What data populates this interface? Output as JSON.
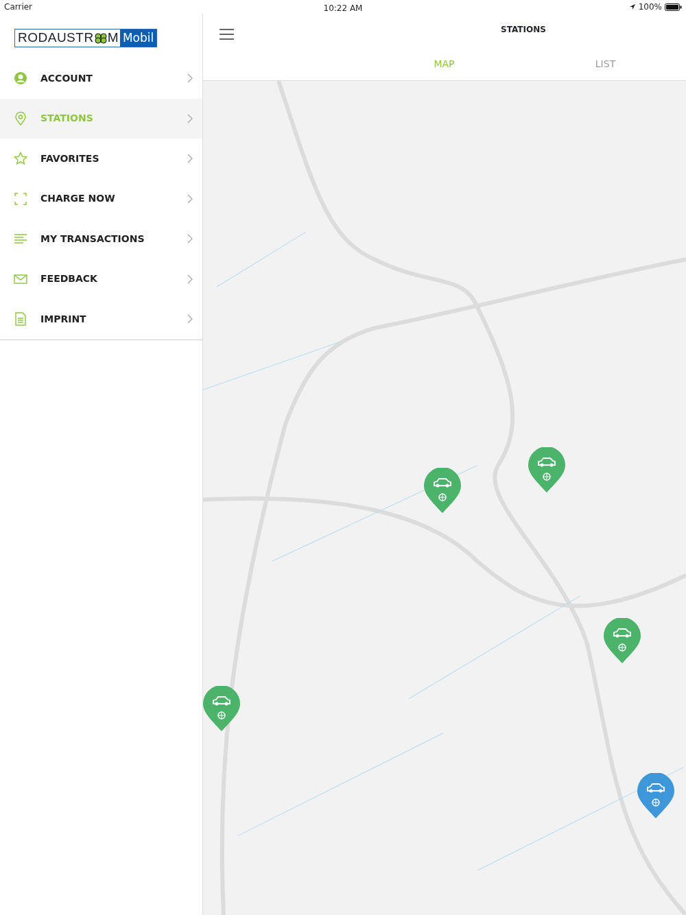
{
  "status_bar": {
    "carrier": "Carrier",
    "time": "10:22 AM",
    "battery": "100%"
  },
  "logo": {
    "left": "RODAUSTR",
    "right": "M",
    "badge": "Mobil"
  },
  "menu": [
    {
      "label": "ACCOUNT",
      "kind": "account",
      "selected": false
    },
    {
      "label": "STATIONS",
      "kind": "stations",
      "selected": true
    },
    {
      "label": "FAVORITES",
      "kind": "favorites",
      "selected": false
    },
    {
      "label": "CHARGE NOW",
      "kind": "charge",
      "selected": false
    },
    {
      "label": "MY TRANSACTIONS",
      "kind": "transactions",
      "selected": false
    },
    {
      "label": "FEEDBACK",
      "kind": "feedback",
      "selected": false
    },
    {
      "label": "IMPRINT",
      "kind": "imprint",
      "selected": false
    }
  ],
  "header": {
    "title": "STATIONS"
  },
  "tabs": [
    {
      "label": "MAP",
      "selected": true
    },
    {
      "label": "LIST",
      "selected": false
    }
  ],
  "map": {
    "markers": [
      {
        "color": "#4cb36b"
      },
      {
        "color": "#4cb36b"
      },
      {
        "color": "#4cb36b"
      },
      {
        "color": "#4cb36b"
      },
      {
        "color": "#3d97d8"
      }
    ]
  }
}
